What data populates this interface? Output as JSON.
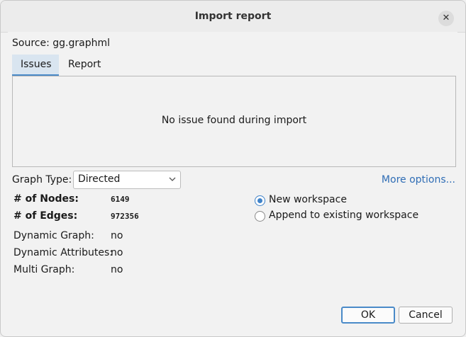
{
  "window": {
    "title": "Import report",
    "close_glyph": "✕"
  },
  "source": {
    "label": "Source:",
    "file": "gg.graphml"
  },
  "tabs": [
    {
      "label": "Issues",
      "active": true
    },
    {
      "label": "Report",
      "active": false
    }
  ],
  "issues": {
    "message": "No issue found during import"
  },
  "graph_type": {
    "label": "Graph Type:",
    "value": "Directed"
  },
  "more_options": "More options...",
  "stats": {
    "nodes_label": "# of Nodes:",
    "nodes_value": "6149",
    "edges_label": "# of Edges:",
    "edges_value": "972356",
    "dynamic_graph_label": "Dynamic Graph:",
    "dynamic_graph_value": "no",
    "dynamic_attributes_label": "Dynamic Attributes:",
    "dynamic_attributes_value": "no",
    "multi_graph_label": "Multi Graph:",
    "multi_graph_value": "no"
  },
  "workspace_options": [
    {
      "label": "New workspace",
      "checked": true
    },
    {
      "label": "Append to existing workspace",
      "checked": false
    }
  ],
  "buttons": {
    "ok": "OK",
    "cancel": "Cancel"
  },
  "colors": {
    "accent": "#4a8ac8",
    "link": "#2f6db5"
  }
}
